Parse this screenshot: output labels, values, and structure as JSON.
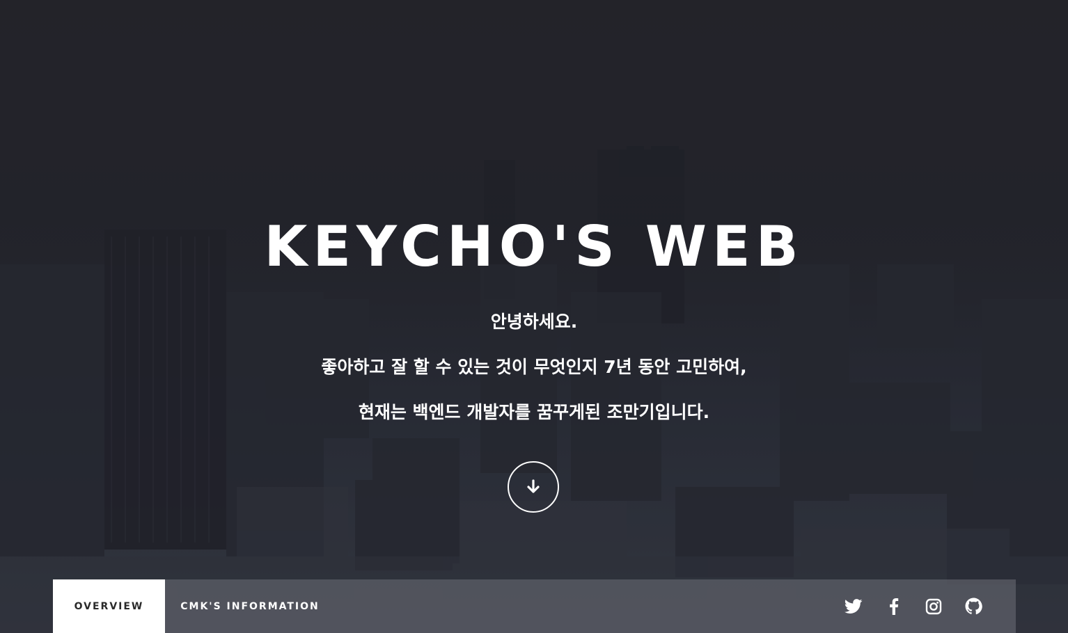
{
  "hero": {
    "title": "KEYCHO'S WEB",
    "lines": [
      "안녕하세요.",
      "좋아하고 잘 할 수 있는 것이 무엇인지 7년 동안 고민하여,",
      "현재는 백엔드 개발자를 꿈꾸게된 조만기입니다."
    ],
    "scroll_icon": "arrow-down-icon"
  },
  "nav": {
    "tabs": [
      {
        "label": "OVERVIEW",
        "active": true
      },
      {
        "label": "CMK'S INFORMATION",
        "active": false
      }
    ],
    "social_icons": [
      "twitter-icon",
      "facebook-icon",
      "instagram-icon",
      "github-icon"
    ]
  },
  "colors": {
    "text": "#ffffff",
    "active_tab_bg": "#ffffff",
    "active_tab_text": "#2a2a2a"
  }
}
